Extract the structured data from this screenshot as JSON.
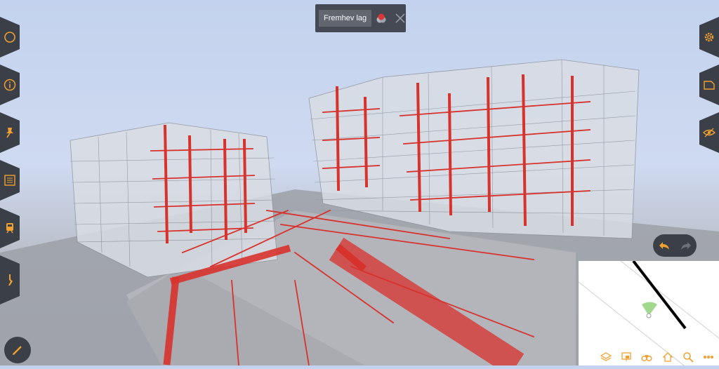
{
  "layer_toolbar": {
    "label": "Fremhev lag"
  },
  "left_rail": [
    "circle-icon",
    "info-icon",
    "pin-icon",
    "list-icon",
    "train-icon",
    "measure-icon"
  ],
  "right_rail": [
    "gear-icon",
    "folder-icon",
    "eye-icon"
  ],
  "minimap_toolbar": [
    "layers-icon",
    "screen-icon",
    "binoculars-icon",
    "home-icon",
    "search-icon",
    "more-icon"
  ],
  "colors": {
    "accent": "#f0a030",
    "panel": "#3b3f48",
    "pipe": "#d8322d"
  }
}
